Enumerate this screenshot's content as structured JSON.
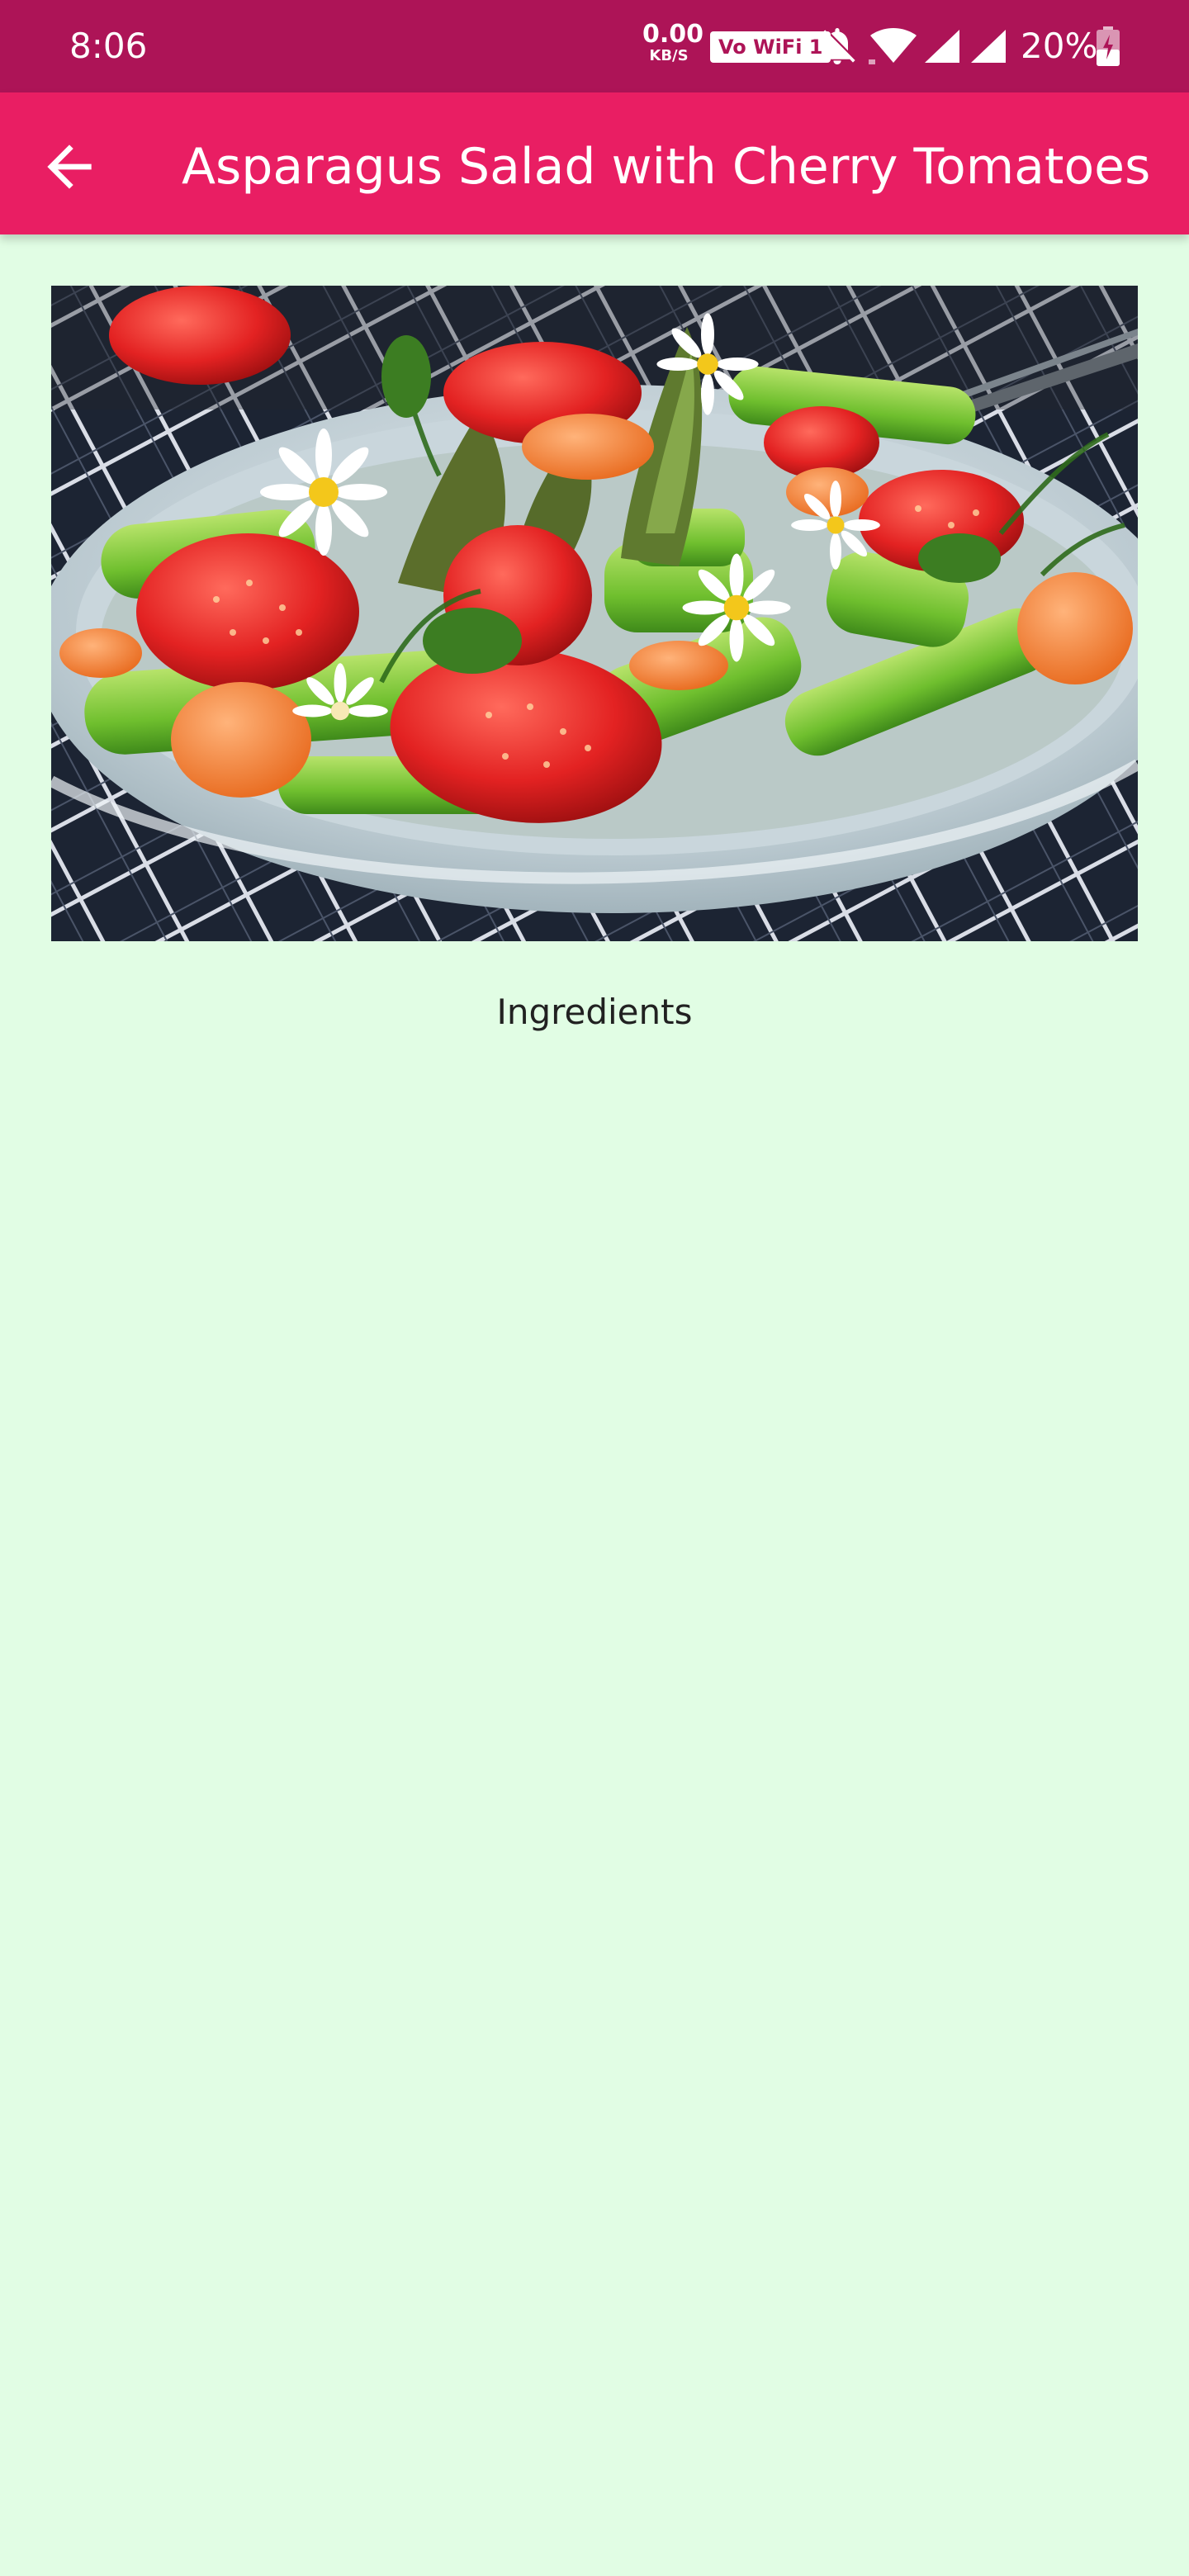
{
  "status_bar": {
    "time": "8:06",
    "net_speed_value": "0.00",
    "net_speed_unit": "KB/S",
    "wifi_badge": "Vo WiFi 1",
    "battery_percent": "20%",
    "icons": [
      "bell-off-icon",
      "wifi-icon",
      "signal-icon",
      "signal-icon",
      "battery-charging-icon"
    ],
    "background_color": "#ad1457"
  },
  "app_bar": {
    "title": "Asparagus Salad with Cherry Tomatoes",
    "back_icon": "arrow-left-icon",
    "background_color": "#e91e63"
  },
  "recipe": {
    "image_subject": "asparagus, strawberries, carrots and daisies in a light blue bowl on a checked cloth",
    "section_heading": "Ingredients"
  },
  "page": {
    "background_color": "#e1fde4"
  }
}
